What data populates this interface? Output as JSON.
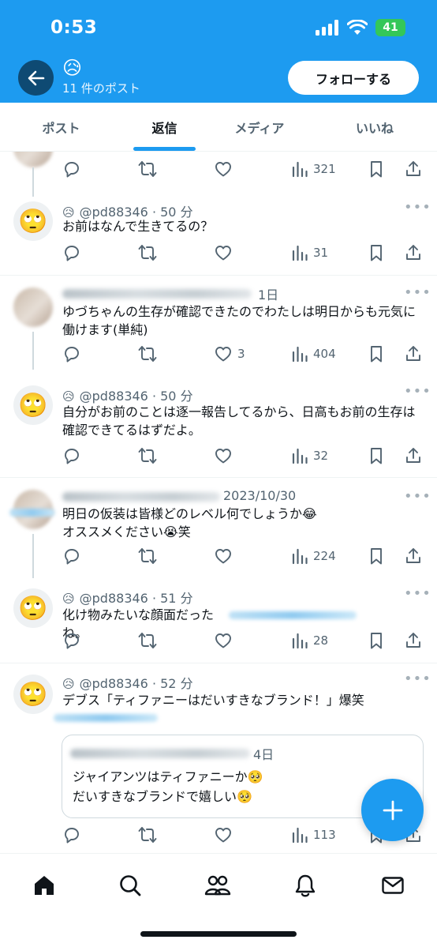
{
  "status_bar": {
    "time": "0:53",
    "battery": "41"
  },
  "header": {
    "profile_emoji": "😥",
    "post_count": "11 件のポスト",
    "follow_label": "フォローする"
  },
  "tabs": [
    {
      "label": "ポスト",
      "active": false
    },
    {
      "label": "返信",
      "active": true
    },
    {
      "label": "メディア",
      "active": false
    },
    {
      "label": "いいね",
      "active": false
    }
  ],
  "posts": [
    {
      "views": "321"
    },
    {
      "avatar_emoji": "🙄",
      "name_emoji": "😥",
      "handle": "@pd88346",
      "time": "50 分",
      "text": "お前はなんで生きてるの？",
      "views": "31"
    },
    {
      "date": "1日",
      "text": "ゆづちゃんの生存が確認できたのでわたしは明日からも元気に働けます(単純)",
      "likes": "3",
      "views": "404"
    },
    {
      "avatar_emoji": "🙄",
      "name_emoji": "😥",
      "handle": "@pd88346",
      "time": "50 分",
      "text": "自分がお前のことは逐一報告してるから、日高もお前の生存は確認できてるはずだよ。",
      "views": "32"
    },
    {
      "date": "2023/10/30",
      "text": "明日の仮装は皆様どのレベル何でしょうか😂\nオススメください😭笑",
      "views": "224"
    },
    {
      "avatar_emoji": "🙄",
      "name_emoji": "😥",
      "handle": "@pd88346",
      "time": "51 分",
      "text": "化け物みたいな顔面だったね。",
      "views": "28"
    },
    {
      "avatar_emoji": "🙄",
      "name_emoji": "😥",
      "handle": "@pd88346",
      "time": "52 分",
      "text": "デブス「ティファニーはだいすきなブランド！」爆笑",
      "views": "113",
      "quote": {
        "date": "4日",
        "text": "ジャイアンツはティファニーか🥺\nだいすきなブランドで嬉しい🥺"
      }
    }
  ],
  "icons": {
    "reply": "reply-icon",
    "retweet": "retweet-icon",
    "like": "heart-icon",
    "views": "views-icon",
    "bookmark": "bookmark-icon",
    "share": "share-icon",
    "compose": "plus-icon",
    "nav": [
      "home-icon",
      "search-icon",
      "communities-icon",
      "bell-icon",
      "mail-icon"
    ]
  },
  "colors": {
    "accent": "#1d9bf0",
    "text": "#0f1419",
    "secondary": "#536471",
    "battery": "#34c759"
  }
}
